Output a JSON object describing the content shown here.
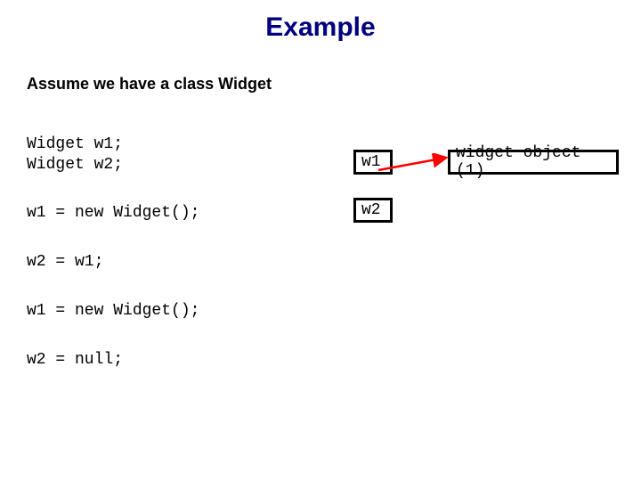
{
  "title": "Example",
  "assume_text": "Assume we have a class Widget",
  "code": {
    "decl1": "Widget w1;",
    "decl2": "Widget w2;",
    "stmt1": "w1 = new Widget();",
    "stmt2": "w2 = w1;",
    "stmt3": "w1 = new Widget();",
    "stmt4": "w2 = null;"
  },
  "diagram": {
    "ref1_label": "w1",
    "ref2_label": "w2",
    "object_label": "widget object (1)",
    "arrow_color": "#ff0000"
  }
}
